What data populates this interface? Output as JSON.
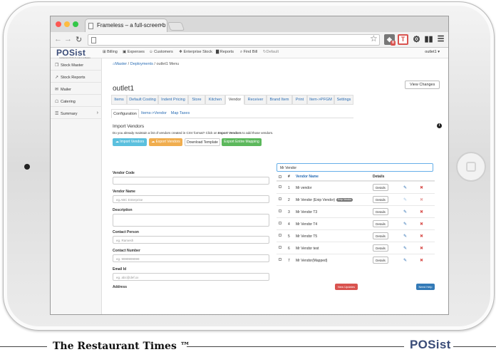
{
  "browser": {
    "tab_title": "Frameless – a full-screen b",
    "tab_close": "×",
    "traffic_lights": [
      "#fc5753",
      "#fdbc40",
      "#33c748"
    ],
    "ext_badge_number": "8",
    "ext_t_label": "T"
  },
  "app": {
    "logo": "POSist",
    "logo_tagline": "restaurant POS & mgmt software",
    "nav": [
      {
        "icon": "cart-icon",
        "glyph": "⊞",
        "label": "Billing"
      },
      {
        "icon": "expenses-icon",
        "glyph": "▣",
        "label": "Expenses"
      },
      {
        "icon": "customers-icon",
        "glyph": "☺",
        "label": "Customers"
      },
      {
        "icon": "stock-icon",
        "glyph": "❖",
        "label": "Enterprise Stock"
      },
      {
        "icon": "reports-icon",
        "glyph": "▇",
        "label": "Reports"
      },
      {
        "icon": "search-icon",
        "glyph": "⌕",
        "label": "Find Bill"
      },
      {
        "icon": "refresh-icon",
        "glyph": "↻",
        "label": "Default"
      }
    ],
    "user_menu": "outlet1 ▾",
    "accent": "#2a6db4"
  },
  "sidebar": {
    "items": [
      {
        "icon": "stock-master-icon",
        "glyph": "❐",
        "label": "Stock Master"
      },
      {
        "icon": "stock-reports-icon",
        "glyph": "↗",
        "label": "Stock Reports"
      },
      {
        "icon": "mailer-icon",
        "glyph": "✉",
        "label": "Mailer"
      },
      {
        "icon": "catering-icon",
        "glyph": "☖",
        "label": "Catering"
      },
      {
        "icon": "summary-icon",
        "glyph": "☰",
        "label": "Summary",
        "chevron": "›"
      }
    ]
  },
  "breadcrumb": {
    "home": "⌂Master",
    "sep": "/",
    "deployments": "Deployments",
    "current": "outlet1 Menu"
  },
  "main": {
    "view_changes": "View Changes",
    "page_title": "outlet1",
    "tabs": [
      "Items",
      "Default Costing",
      "Indent Pricing",
      "Store",
      "Kitchen",
      "Vendor",
      "Receiver",
      "Brand Item",
      "Print",
      "Item->PFGM",
      "Settings"
    ],
    "subtabs": [
      "Configuration",
      "Items->Vendor",
      "Map Taxes"
    ],
    "section_title": "Import Vendors",
    "desc_prefix": "Do you already maintain a list of vendors created in CSV format? Click on ",
    "desc_bold": "Import Vendors",
    "desc_suffix": " to add those vendors.",
    "buttons": {
      "import": "☁ Import Vendors",
      "export": "☁ Export Vendors",
      "download": "Download Template",
      "export_mapping": "Export Entire Mapping"
    }
  },
  "form": {
    "vendor_code_label": "Vendor Code",
    "vendor_code_value": "",
    "vendor_name_label": "Vendor Name",
    "vendor_name_placeholder": "eg.ABC Enterprise",
    "description_label": "Description",
    "contact_person_label": "Contact Person",
    "contact_person_placeholder": "eg. Ramesh",
    "contact_number_label": "Contact Number",
    "contact_number_placeholder": "eg. 9999999999",
    "email_label": "Email Id",
    "email_placeholder": "eg. abc@def.xx",
    "address_label": "Address"
  },
  "vendors": {
    "search_value": "Mr Vendor",
    "col_num": "#",
    "col_name": "Vendor Name",
    "col_details": "Details",
    "details_label": "Details",
    "edit_glyph": "✎",
    "delete_glyph": "✖",
    "rows": [
      {
        "num": "1",
        "name": "Mr vendor",
        "badge": "",
        "dim": false
      },
      {
        "num": "2",
        "name": "Mr Vendor (Enip Vendor)",
        "badge": "Enip Vendor",
        "dim": true
      },
      {
        "num": "3",
        "name": "Mr Vendor T3",
        "badge": "",
        "dim": false
      },
      {
        "num": "4",
        "name": "Mr Vendor T4",
        "badge": "",
        "dim": false
      },
      {
        "num": "5",
        "name": "Mr Vendor T5",
        "badge": "",
        "dim": false
      },
      {
        "num": "6",
        "name": "Mr Vendor test",
        "badge": "",
        "dim": false
      },
      {
        "num": "7",
        "name": "Mr Vendor(Mapped)",
        "badge": "",
        "dim": false
      }
    ]
  },
  "floating": {
    "new_updates": "New Updates",
    "need_help": "Need Help"
  },
  "footer": {
    "brand": "The Restaurant Times ™",
    "logo": "POSist"
  }
}
